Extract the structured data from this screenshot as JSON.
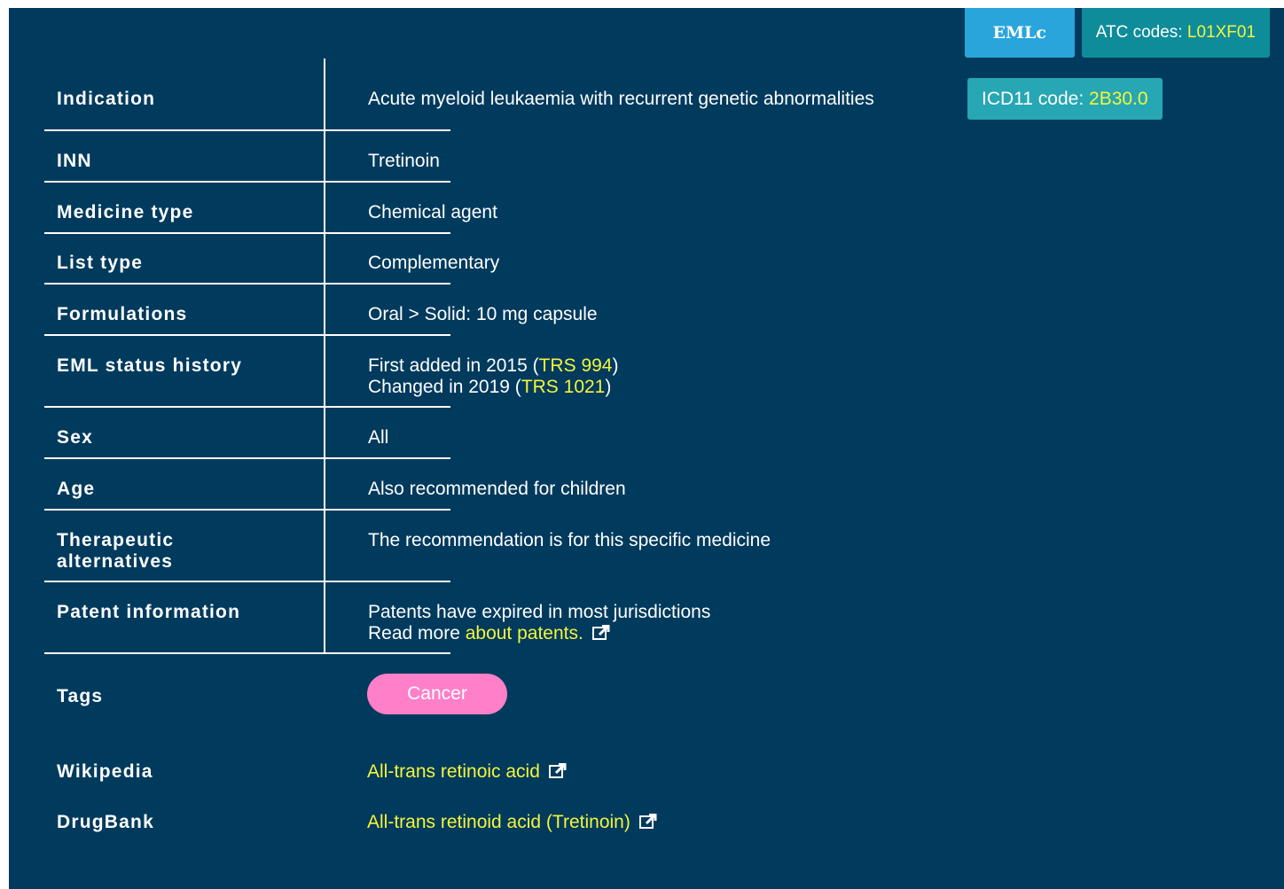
{
  "header": {
    "list_badge": "EMLc",
    "atc_label": "ATC codes:",
    "atc_code": "L01XF01"
  },
  "rows": {
    "indication": {
      "label": "Indication",
      "value": "Acute myeloid leukaemia with recurrent genetic abnormalities",
      "icd_label": "ICD11 code:",
      "icd_code": "2B30.0"
    },
    "inn": {
      "label": "INN",
      "value": "Tretinoin"
    },
    "medicine_type": {
      "label": "Medicine type",
      "value": "Chemical agent"
    },
    "list_type": {
      "label": "List type",
      "value": "Complementary"
    },
    "formulations": {
      "label": "Formulations",
      "value": "Oral > Solid: 10 mg capsule"
    },
    "status_history": {
      "label": "EML status history",
      "line1_prefix": "First added in 2015 (",
      "line1_link": "TRS 994",
      "line1_suffix": ")",
      "line2_prefix": "Changed in 2019 (",
      "line2_link": "TRS 1021",
      "line2_suffix": ")"
    },
    "sex": {
      "label": "Sex",
      "value": "All"
    },
    "age": {
      "label": "Age",
      "value": "Also recommended for children"
    },
    "therapeutic": {
      "label_line1": "Therapeutic",
      "label_line2": "alternatives",
      "value": "The recommendation is for this specific medicine"
    },
    "patent": {
      "label": "Patent information",
      "line1": "Patents have expired in most jurisdictions",
      "line2_prefix": "Read more ",
      "line2_link": "about patents."
    },
    "tags": {
      "label": "Tags",
      "tag": "Cancer"
    },
    "wikipedia": {
      "label": "Wikipedia",
      "link": "All-trans retinoic acid"
    },
    "drugbank": {
      "label": "DrugBank",
      "link": "All-trans retinoid acid (Tretinoin)"
    }
  },
  "colors": {
    "background": "#003a5d",
    "link": "#f4f53a",
    "eml_badge": "#2aa5dc",
    "atc_badge": "#0e8c9a",
    "icd_badge": "#26a7b3",
    "tag": "#ff7fc8"
  },
  "icons": {
    "external_link": "external-link-icon"
  }
}
